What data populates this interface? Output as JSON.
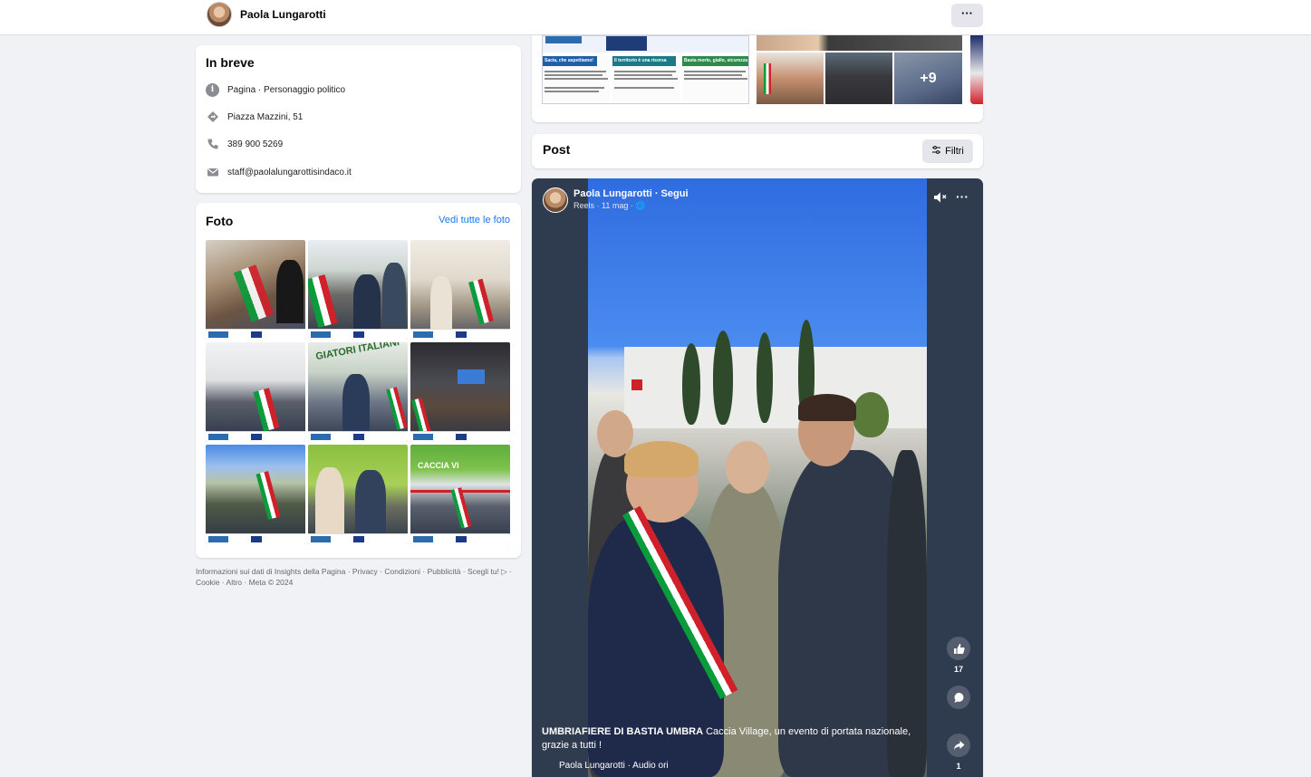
{
  "page": {
    "name": "Paola Lungarotti",
    "more_label": "···"
  },
  "intro": {
    "title": "In breve",
    "items": [
      {
        "icon": "info-icon",
        "text": "Pagina · Personaggio politico"
      },
      {
        "icon": "location-icon",
        "text": "Piazza Mazzini, 51"
      },
      {
        "icon": "phone-icon",
        "text": "389 900 5269"
      },
      {
        "icon": "email-icon",
        "text": "staff@paolalungarottisindaco.it"
      }
    ]
  },
  "photos": {
    "title": "Foto",
    "see_all": "Vedi tutte le foto"
  },
  "footer": {
    "text": "Informazioni sui dati di Insights della Pagina · Privacy · Condizioni · Pubblicità · Scegli tu! ▷ · Cookie · Altro · Meta © 2024"
  },
  "media": {
    "doc_labels": [
      "Sacia, che aspettiamo!",
      "Il territorio è una risorsa",
      "Basta morte, giallo, sicurezza stessa!"
    ],
    "more_count": "+9"
  },
  "posts": {
    "title": "Post",
    "filter_label": "Filtri"
  },
  "reel": {
    "author": "Paola Lungarotti · Segui",
    "meta": "Reels · 11 mag · 🌐",
    "caption_bold": "UMBRIAFIERE DI BASTIA UMBRA",
    "caption_rest": " Caccia Village, un evento di portata nazionale, grazie a tutti !",
    "audio": "Paola Lungarotti · Audio ori",
    "like_count": "17",
    "share_count": "1"
  },
  "colors": {
    "accent": "#1877f2",
    "background": "#f0f2f5",
    "reel_bg": "#2f3b4f"
  }
}
